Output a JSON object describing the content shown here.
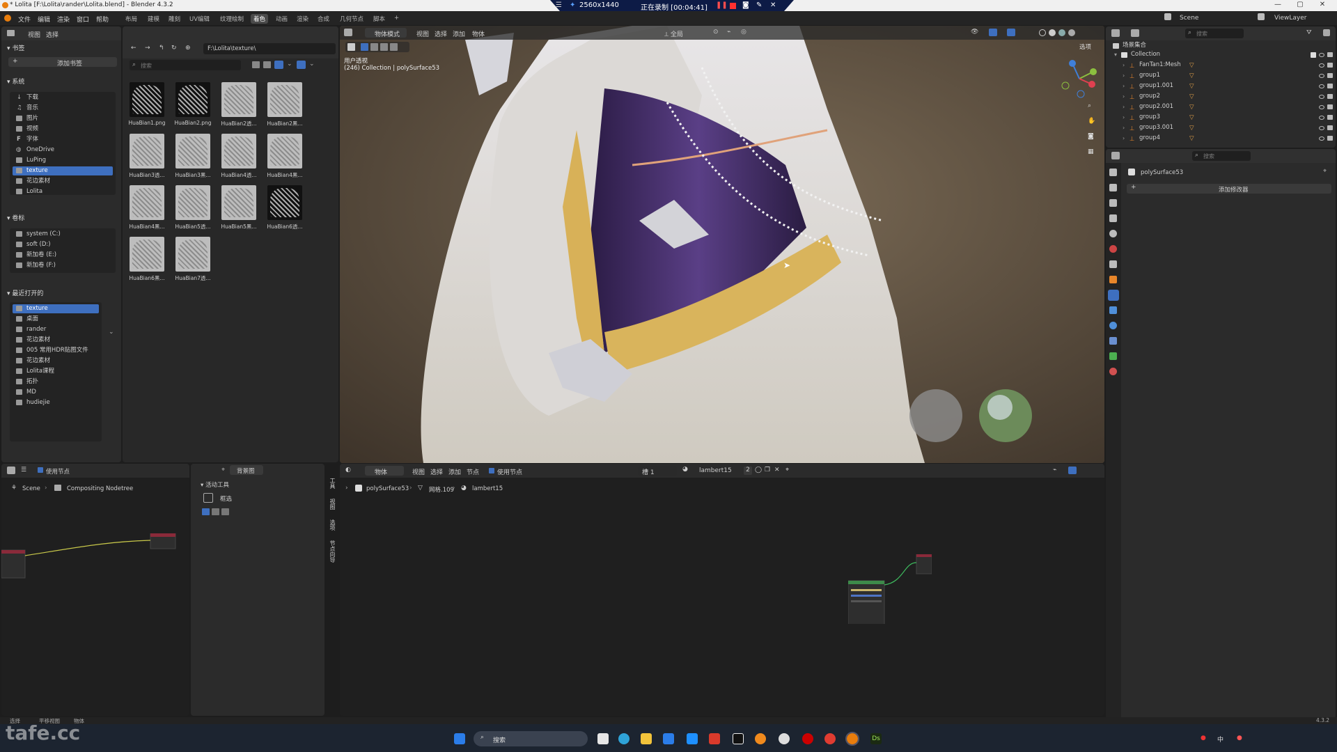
{
  "titlebar": {
    "title": "* Lolita [F:\\Lolita\\rander\\Lolita.blend] - Blender 4.3.2"
  },
  "recording": {
    "resolution": "2560x1440",
    "status": "正在录制 [00:04:41]"
  },
  "menu": [
    "文件",
    "编辑",
    "渲染",
    "窗口",
    "帮助"
  ],
  "workspaces": [
    "布局",
    "建模",
    "雕刻",
    "UV编辑",
    "纹理绘制",
    "着色",
    "动画",
    "渲染",
    "合成",
    "几何节点",
    "脚本",
    "+"
  ],
  "active_workspace": "着色",
  "topright": {
    "scene": "Scene",
    "viewlayer": "ViewLayer"
  },
  "filebrowser": {
    "header_menu": [
      "视图",
      "选择"
    ],
    "path": "F:\\Lolita\\texture\\",
    "search_placeholder": "搜索",
    "bookmarks_title": "书签",
    "add_bookmark": "添加书签",
    "system_title": "系统",
    "system_items": [
      "下载",
      "音乐",
      "图片",
      "视频",
      "字体",
      "OneDrive",
      "LuPing",
      "texture",
      "花边素材",
      "Lolita"
    ],
    "system_selected": 7,
    "volumes_title": "卷标",
    "volumes": [
      "system (C:)",
      "soft (D:)",
      "新加卷 (E:)",
      "新加卷 (F:)"
    ],
    "recent_title": "最近打开的",
    "recent": [
      "texture",
      "桌面",
      "rander",
      "花边素材",
      "005 常用HDR贴图文件",
      "花边素材",
      "Lolita课程",
      "拓扑",
      "MD",
      "hudiejie"
    ],
    "recent_selected": 0,
    "files": [
      "HuaBian1.png",
      "HuaBian2.png",
      "HuaBian2透...",
      "HuaBian2黑...",
      "HuaBian3透...",
      "HuaBian3黑...",
      "HuaBian4透...",
      "HuaBian4黑...",
      "HuaBian4黑...",
      "HuaBian5透...",
      "HuaBian5黑...",
      "HuaBian6透...",
      "HuaBian6黑...",
      "HuaBian7透..."
    ]
  },
  "viewport": {
    "mode": "物体模式",
    "menu": [
      "视图",
      "选择",
      "添加",
      "物体"
    ],
    "global": "全局",
    "options": "选项",
    "overlay_title": "用户透视",
    "overlay_sub": "(246) Collection | polySurface53"
  },
  "outliner": {
    "search_placeholder": "搜索",
    "scene_collection": "场景集合",
    "collection": "Collection",
    "items": [
      "FanTan1:Mesh",
      "group1",
      "group1.001",
      "group2",
      "group2.001",
      "group3",
      "group3.001",
      "group4"
    ]
  },
  "properties": {
    "search_placeholder": "搜索",
    "object": "polySurface53",
    "add_modifier": "添加修改器"
  },
  "compositor": {
    "use_nodes": "使用节点",
    "backdrop": "背景图",
    "breadcrumb_scene": "Scene",
    "breadcrumb_tree": "Compositing Nodetree",
    "active_tool": "活动工具",
    "tool_name": "框选",
    "side_tabs": [
      "工具",
      "视图",
      "选项",
      "节点向导"
    ]
  },
  "shader": {
    "type": "物体",
    "menu": [
      "视图",
      "选择",
      "添加",
      "节点"
    ],
    "use_nodes": "使用节点",
    "slot": "槽 1",
    "material": "lambert15",
    "users": "2",
    "breadcrumb": [
      "polySurface53",
      "网格.109",
      "lambert15"
    ]
  },
  "statusbar": {
    "left": [
      "选择",
      "平移视图",
      "物体"
    ],
    "version": "4.3.2"
  },
  "watermark": "tafe.cc",
  "taskbar": {
    "search": "搜索"
  }
}
